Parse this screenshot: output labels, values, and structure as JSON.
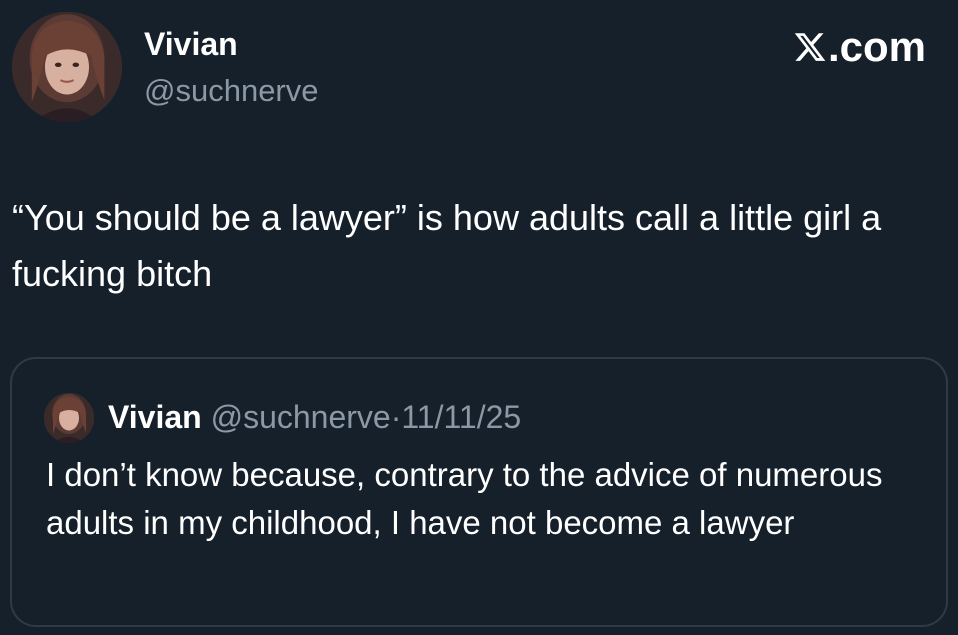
{
  "author": {
    "display_name": "Vivian",
    "handle": "@suchnerve",
    "avatar_icon": "profile-photo-avatar"
  },
  "site_badge": {
    "logo_icon": "x-logo-icon",
    "suffix": ".com"
  },
  "tweet": {
    "text": "“You should be a lawyer” is how adults call a little girl a fucking bitch"
  },
  "quoted_tweet": {
    "display_name": "Vivian",
    "handle": "@suchnerve",
    "separator": "·",
    "date": "11/11/25",
    "text": "I don’t know because, contrary to the advice of numerous adults in my childhood, I have not become a lawyer"
  },
  "colors": {
    "background": "#16202b",
    "primary_text": "#ffffff",
    "secondary_text": "#8b98a5",
    "card_border": "#2f3a46"
  }
}
